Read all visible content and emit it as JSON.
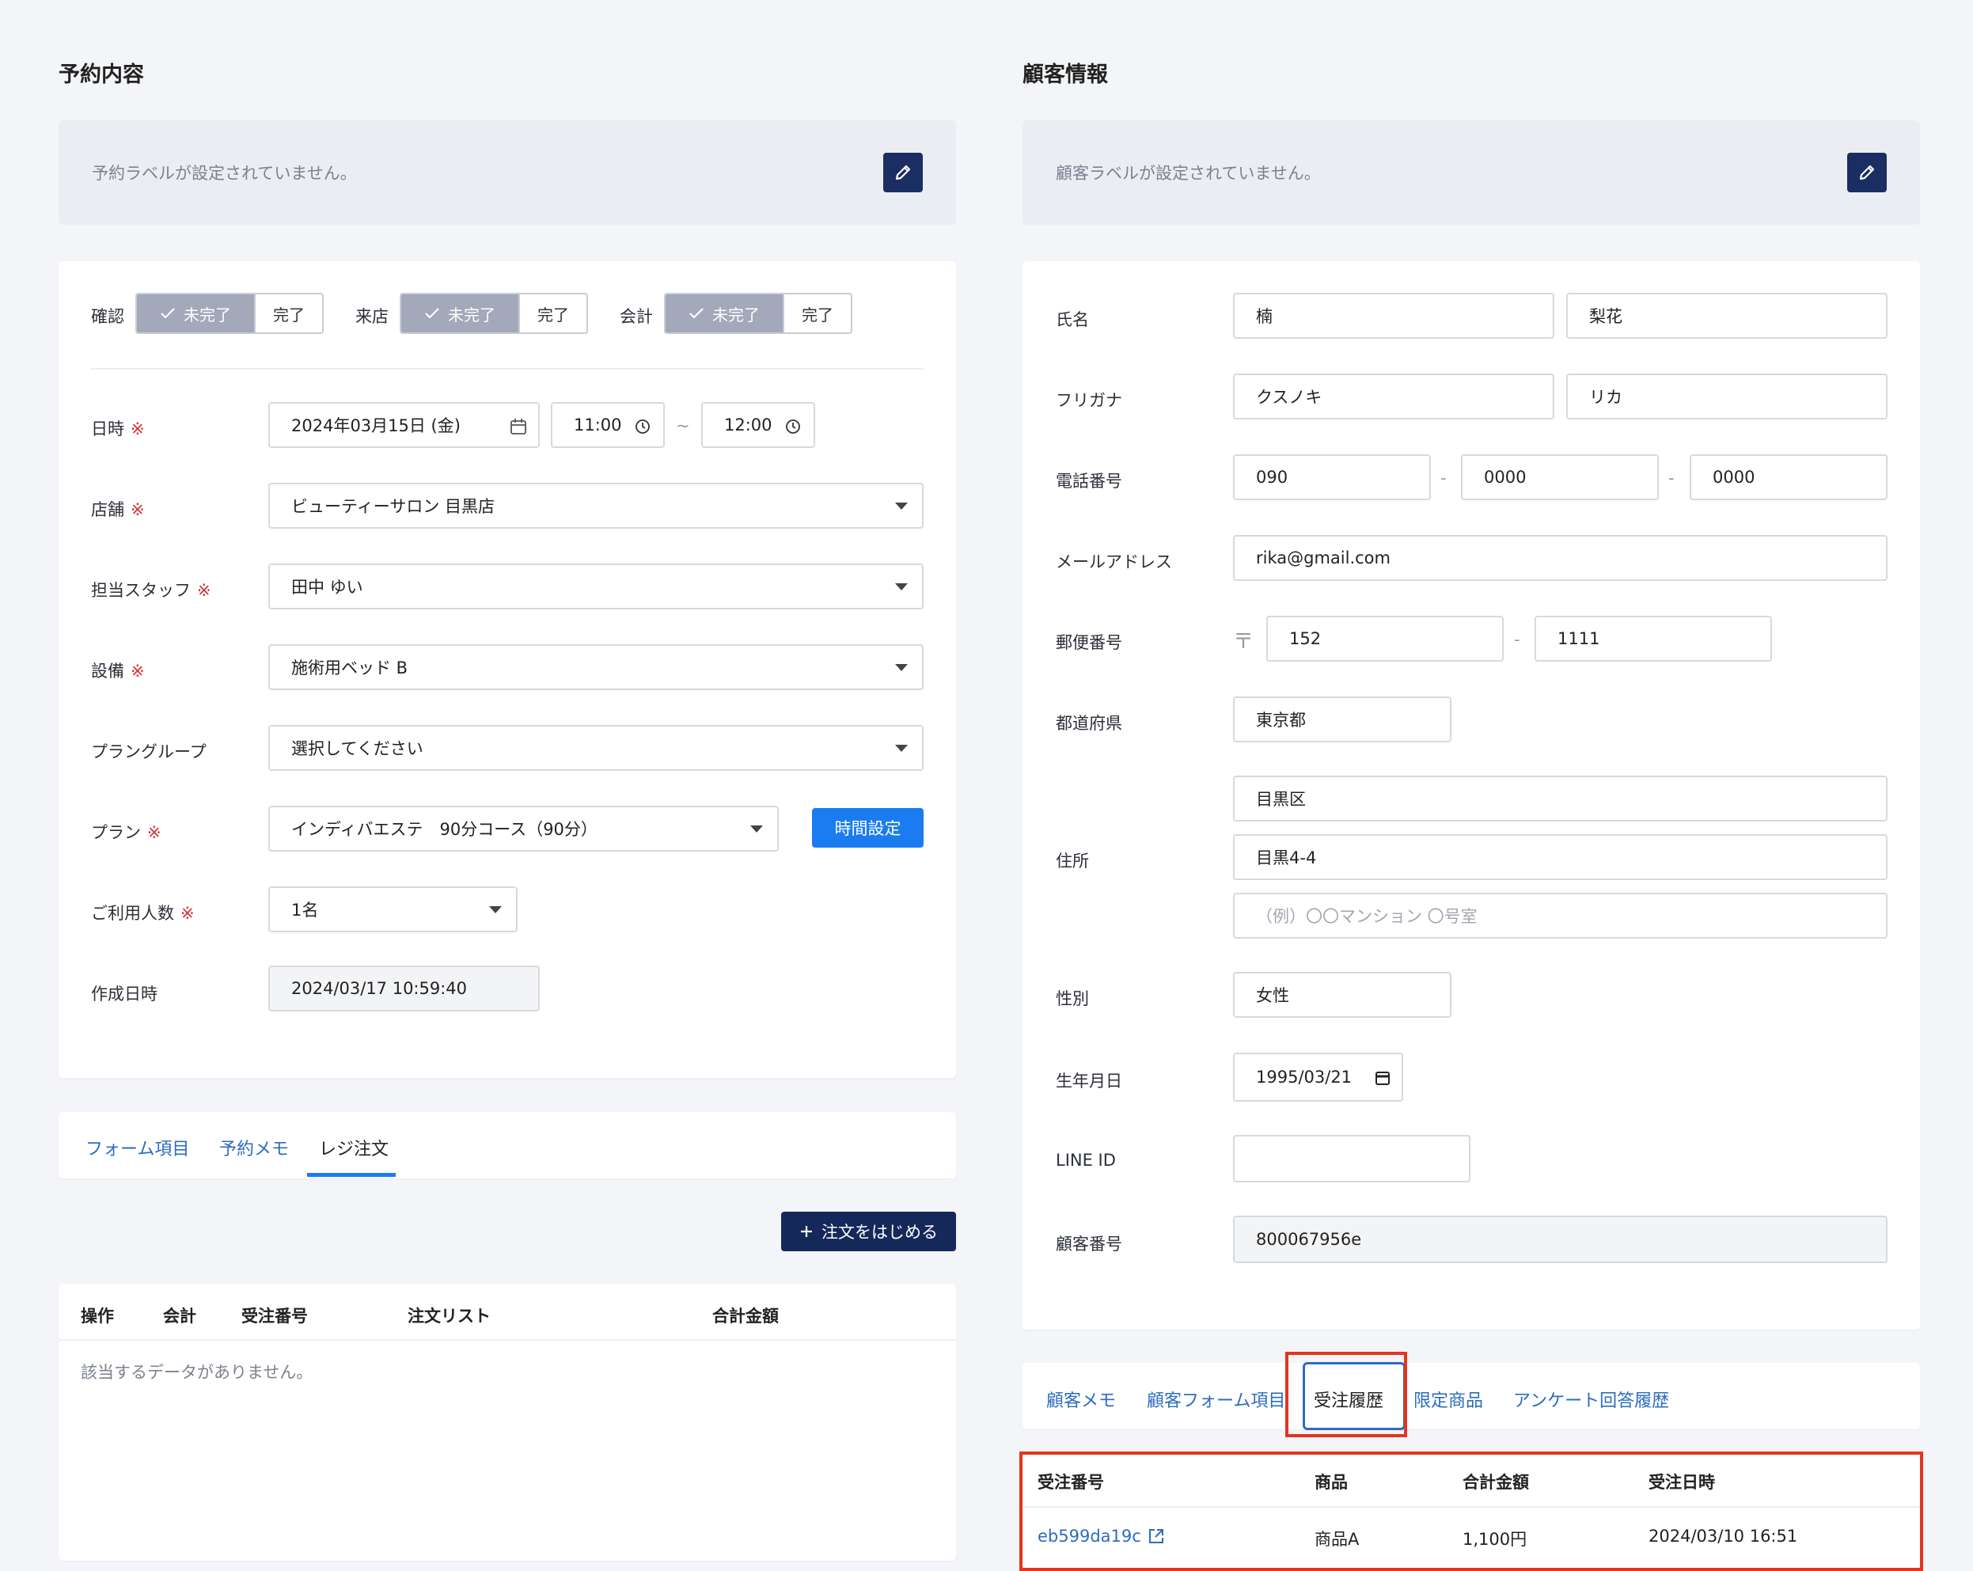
{
  "left": {
    "title": "予約内容",
    "label_placeholder": "予約ラベルが設定されていません。",
    "status": [
      {
        "label": "確認",
        "incomplete": "未完了",
        "complete": "完了"
      },
      {
        "label": "来店",
        "incomplete": "未完了",
        "complete": "完了"
      },
      {
        "label": "会計",
        "incomplete": "未完了",
        "complete": "完了"
      }
    ],
    "required_mark": "※",
    "datetime": {
      "label": "日時",
      "date": "2024年03月15日 (金)",
      "start": "11:00",
      "tilde": "~",
      "end": "12:00"
    },
    "store": {
      "label": "店舗",
      "value": "ビューティーサロン 目黒店"
    },
    "staff": {
      "label": "担当スタッフ",
      "value": "田中 ゆい"
    },
    "equipment": {
      "label": "設備",
      "value": "施術用ベッド B"
    },
    "plan_group": {
      "label": "プラングループ",
      "value": "選択してください"
    },
    "plan": {
      "label": "プラン",
      "value": "インディバエステ　90分コース（90分）",
      "button": "時間設定"
    },
    "people": {
      "label": "ご利用人数",
      "value": "1名"
    },
    "created": {
      "label": "作成日時",
      "value": "2024/03/17 10:59:40"
    },
    "tabs": [
      "フォーム項目",
      "予約メモ",
      "レジ注文"
    ],
    "start_order_button": "注文をはじめる",
    "orders_table": {
      "headers": [
        "操作",
        "会計",
        "受注番号",
        "注文リスト",
        "合計金額"
      ],
      "empty": "該当するデータがありません。"
    }
  },
  "right": {
    "title": "顧客情報",
    "label_placeholder": "顧客ラベルが設定されていません。",
    "name": {
      "label": "氏名",
      "last": "楠",
      "first": "梨花"
    },
    "kana": {
      "label": "フリガナ",
      "last": "クスノキ",
      "first": "リカ"
    },
    "phone": {
      "label": "電話番号",
      "p1": "090",
      "p2": "0000",
      "p3": "0000",
      "sep": "-"
    },
    "email": {
      "label": "メールアドレス",
      "value": "rika@gmail.com"
    },
    "postal": {
      "label": "郵便番号",
      "mark": "〒",
      "p1": "152",
      "p2": "1111",
      "sep": "-"
    },
    "prefecture": {
      "label": "都道府県",
      "value": "東京都"
    },
    "address": {
      "label": "住所",
      "line1": "目黒区",
      "line2": "目黒4-4",
      "line3_placeholder": "（例）〇〇マンション 〇号室"
    },
    "gender": {
      "label": "性別",
      "value": "女性"
    },
    "birthday": {
      "label": "生年月日",
      "value": "1995/03/21"
    },
    "line_id": {
      "label": "LINE ID",
      "value": ""
    },
    "customer_no": {
      "label": "顧客番号",
      "value": "800067956e"
    },
    "tabs": [
      "顧客メモ",
      "顧客フォーム項目",
      "受注履歴",
      "限定商品",
      "アンケート回答履歴"
    ],
    "history_table": {
      "headers": [
        "受注番号",
        "商品",
        "合計金額",
        "受注日時"
      ],
      "rows": [
        {
          "order_no": "eb599da19c",
          "product": "商品A",
          "total": "1,100円",
          "date": "2024/03/10 16:51"
        }
      ]
    }
  },
  "colors": {
    "accent": "#1a7cf0",
    "navy": "#14285a",
    "link": "#2d6bbf",
    "required": "#d4323a",
    "highlight": "#e5331f"
  }
}
